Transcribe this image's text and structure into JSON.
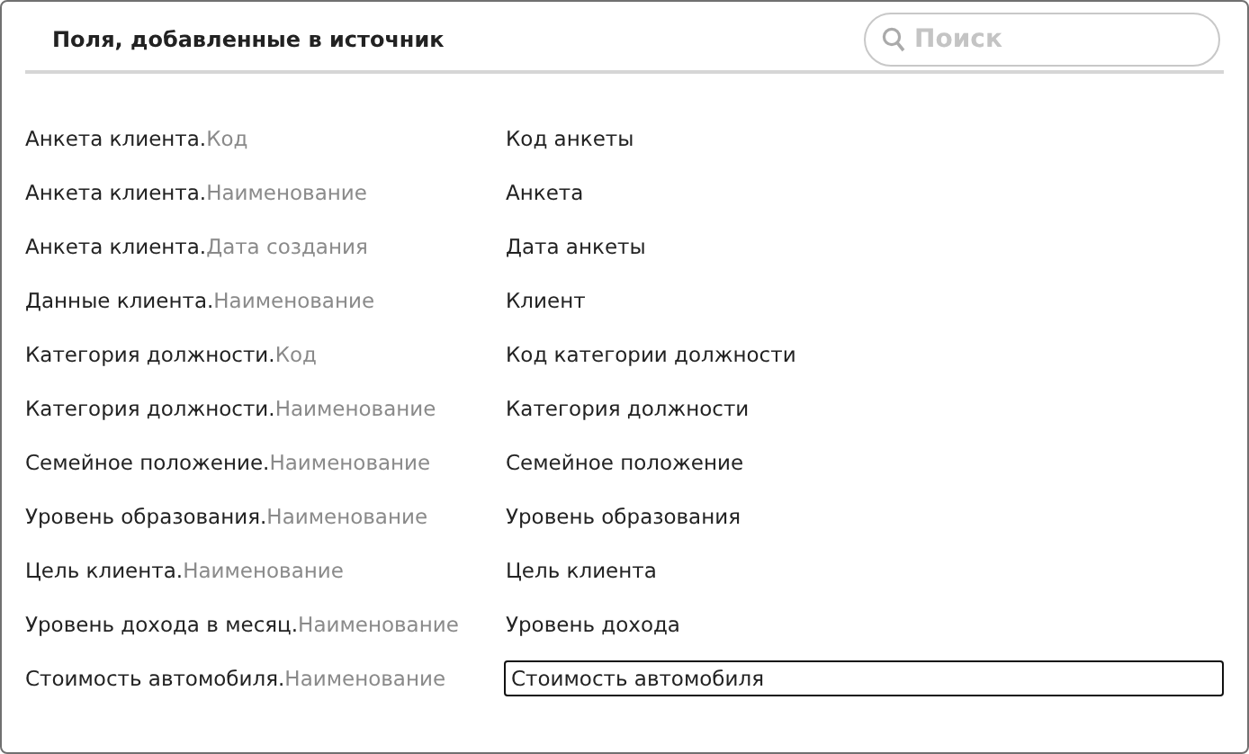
{
  "title": "Поля, добавленные в источник",
  "search": {
    "placeholder": "Поиск"
  },
  "rows": [
    {
      "object": "Анкета клиента.",
      "field": "Код",
      "alias": "Код анкеты",
      "editing": false
    },
    {
      "object": "Анкета клиента.",
      "field": "Наименование",
      "alias": "Анкета",
      "editing": false
    },
    {
      "object": "Анкета клиента.",
      "field": "Дата создания",
      "alias": "Дата анкеты",
      "editing": false
    },
    {
      "object": "Данные клиента.",
      "field": "Наименование",
      "alias": "Клиент",
      "editing": false
    },
    {
      "object": "Категория должности.",
      "field": "Код",
      "alias": "Код категории должности",
      "editing": false
    },
    {
      "object": "Категория должности.",
      "field": "Наименование",
      "alias": "Категория должности",
      "editing": false
    },
    {
      "object": "Семейное положение.",
      "field": "Наименование",
      "alias": "Семейное положение",
      "editing": false
    },
    {
      "object": "Уровень образования.",
      "field": "Наименование",
      "alias": "Уровень образования",
      "editing": false
    },
    {
      "object": "Цель клиента.",
      "field": "Наименование",
      "alias": "Цель клиента",
      "editing": false
    },
    {
      "object": "Уровень дохода в месяц.",
      "field": "Наименование",
      "alias": "Уровень дохода",
      "editing": false
    },
    {
      "object": "Стоимость автомобиля.",
      "field": "Наименование",
      "alias": "Стоимость автомобиля",
      "editing": true
    }
  ]
}
